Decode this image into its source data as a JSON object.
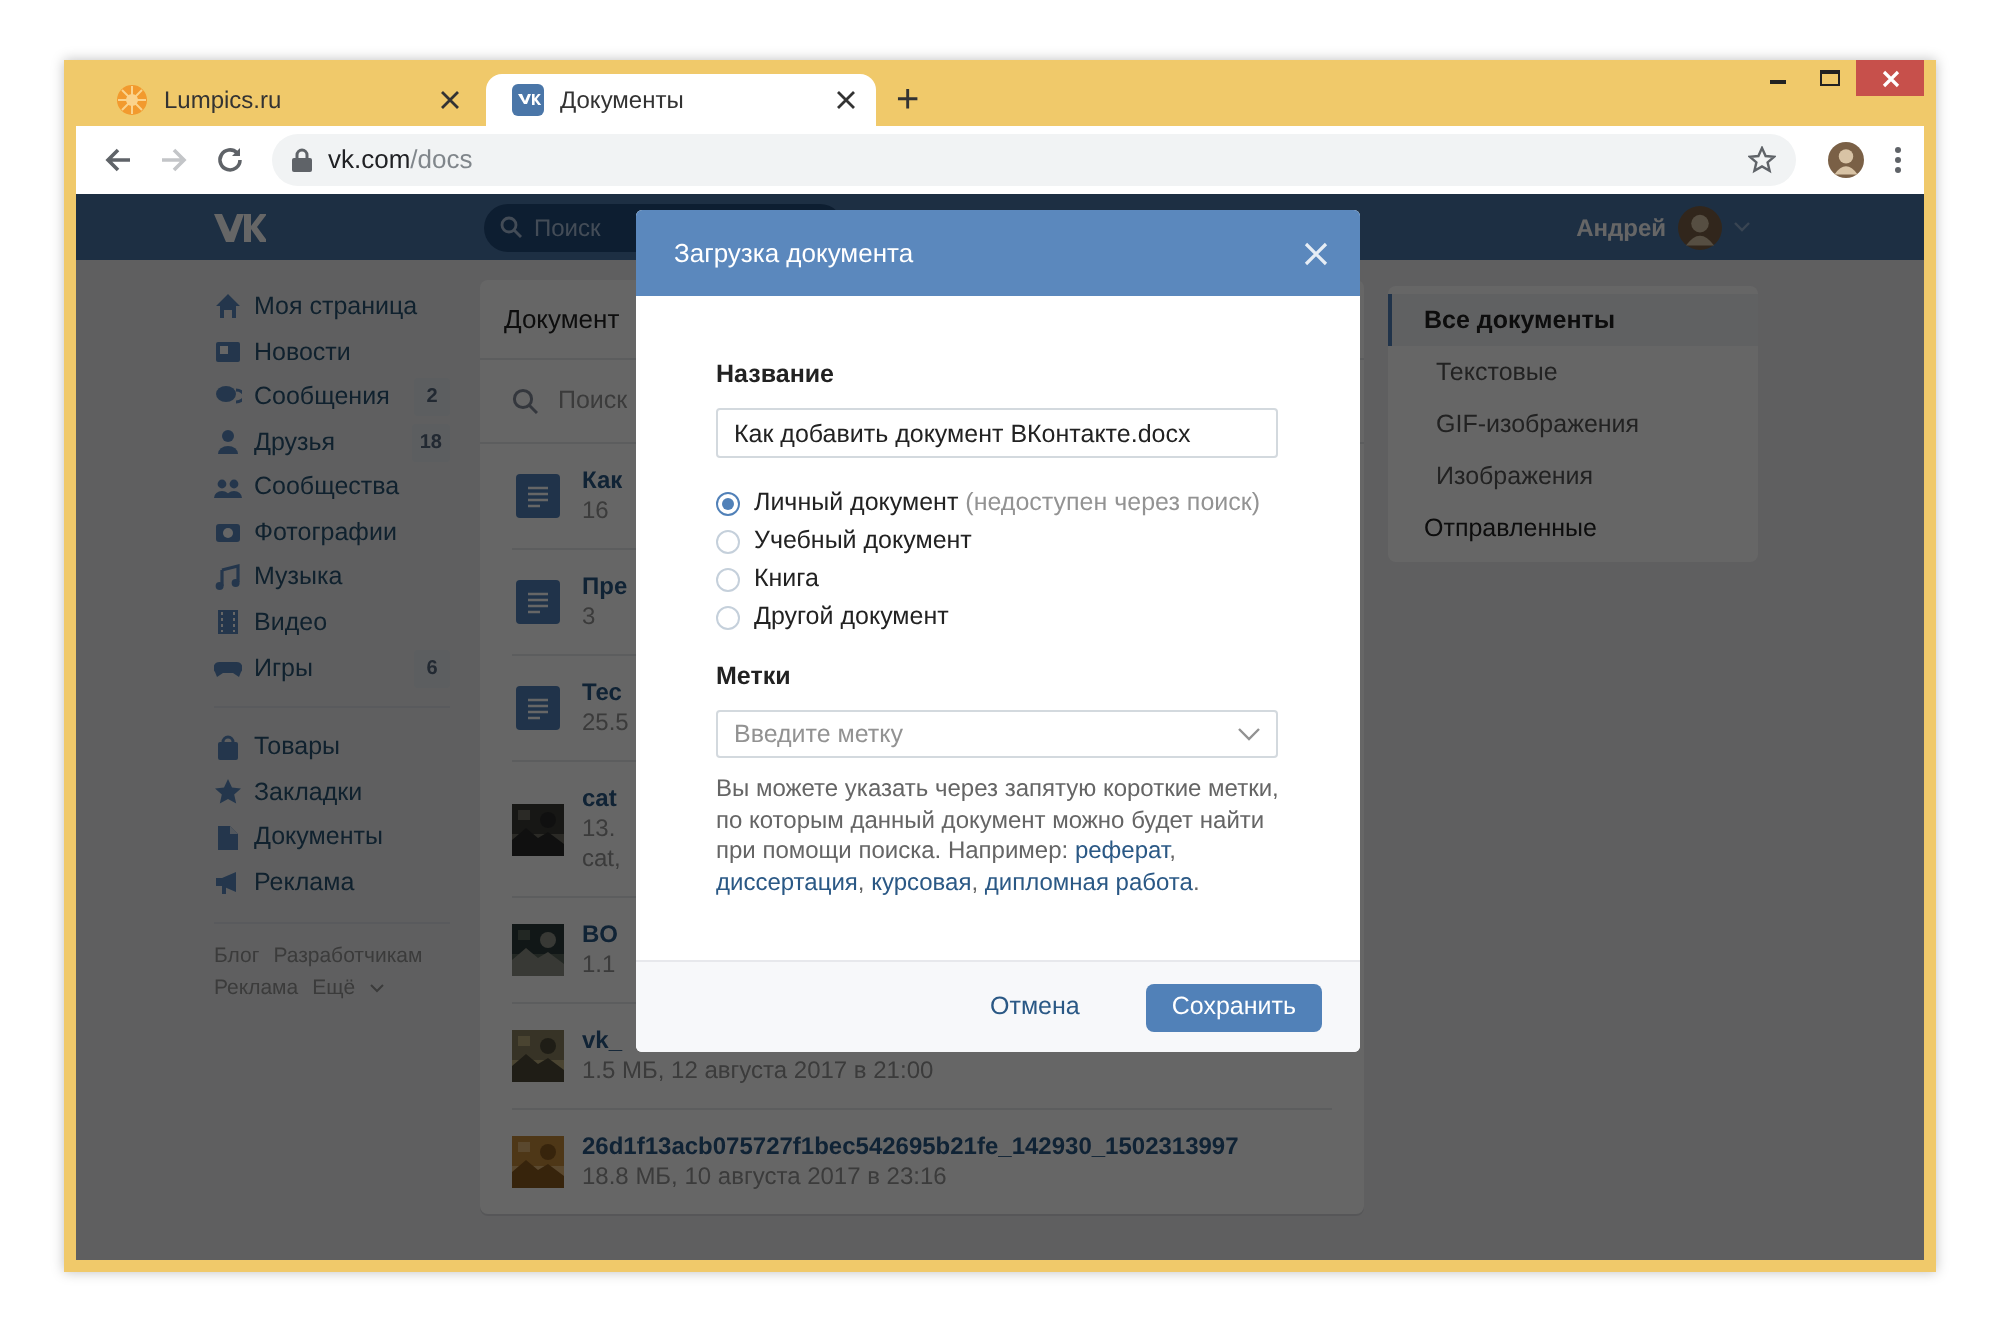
{
  "browser": {
    "tabs": [
      {
        "title": "Lumpics.ru",
        "selected": false
      },
      {
        "title": "Документы",
        "selected": true
      }
    ],
    "new_tab": "+",
    "forward_disabled": true,
    "address": {
      "host": "vk.com",
      "path": "/docs"
    }
  },
  "header": {
    "search_placeholder": "Поиск",
    "user_name": "Андрей"
  },
  "menu": {
    "groups": [
      [
        {
          "label": "Моя страница"
        },
        {
          "label": "Новости"
        },
        {
          "label": "Сообщения",
          "count": "2"
        },
        {
          "label": "Друзья",
          "count": "18"
        },
        {
          "label": "Сообщества"
        },
        {
          "label": "Фотографии"
        },
        {
          "label": "Музыка"
        },
        {
          "label": "Видео"
        },
        {
          "label": "Игры",
          "count": "6"
        }
      ],
      [
        {
          "label": "Товары"
        },
        {
          "label": "Закладки"
        },
        {
          "label": "Документы"
        },
        {
          "label": "Реклама"
        }
      ]
    ],
    "footer_links": [
      "Блог",
      "Разработчикам",
      "Реклама",
      "Ещё"
    ]
  },
  "docs": {
    "title": "Документ",
    "search_placeholder": "Поиск",
    "items": [
      {
        "kind": "doc",
        "title": "Как",
        "meta": "16"
      },
      {
        "kind": "doc",
        "title": "Пре",
        "meta": "3"
      },
      {
        "kind": "doc",
        "title": "Тес",
        "meta": "25.5"
      },
      {
        "kind": "picture",
        "title": "cat",
        "meta": "13.",
        "tags": "cat,"
      },
      {
        "kind": "picture",
        "title": "BO",
        "meta": "1.1"
      },
      {
        "kind": "picture",
        "title": "vk_",
        "meta": "1.5 МБ, 12 августа 2017 в 21:00"
      },
      {
        "kind": "picture",
        "title": "26d1f13acb075727f1bec542695b21fe_142930_1502313997",
        "meta": "18.8 МБ, 10 августа 2017 в 23:16"
      }
    ]
  },
  "filters": [
    {
      "label": "Все документы",
      "selected": true,
      "children": [
        {
          "label": "Текстовые",
          "selected": false
        },
        {
          "label": "GIF-изображения",
          "selected": false
        },
        {
          "label": "Изображения",
          "selected": false
        }
      ]
    },
    {
      "label": "Отправленные",
      "selected": false
    }
  ],
  "modal": {
    "title": "Загрузка документа",
    "name_label": "Название",
    "name_value": "Как добавить документ ВКонтакте.docx",
    "types": [
      {
        "label": "Личный документ",
        "note": "(недоступен через поиск)",
        "selected": true
      },
      {
        "label": "Учебный документ",
        "selected": false
      },
      {
        "label": "Книга",
        "selected": false
      },
      {
        "label": "Другой документ",
        "selected": false
      }
    ],
    "tags_label": "Метки",
    "tags_placeholder": "Введите метку",
    "help": [
      {
        "kind": "text",
        "text": "Вы можете указать через запятую короткие метки, по которым данный документ можно будет найти при помощи поиска. Например: "
      },
      {
        "kind": "link",
        "text": "реферат"
      },
      {
        "kind": "text",
        "text": ", "
      },
      {
        "kind": "link",
        "text": "диссертация"
      },
      {
        "kind": "text",
        "text": ", "
      },
      {
        "kind": "link",
        "text": "курсовая"
      },
      {
        "kind": "text",
        "text": ", "
      },
      {
        "kind": "link",
        "text": "дипломная работа"
      },
      {
        "kind": "text",
        "text": "."
      }
    ],
    "buttons": [
      {
        "label": "Отмена",
        "kind": "secondary"
      },
      {
        "label": "Сохранить",
        "kind": "primary"
      }
    ]
  }
}
